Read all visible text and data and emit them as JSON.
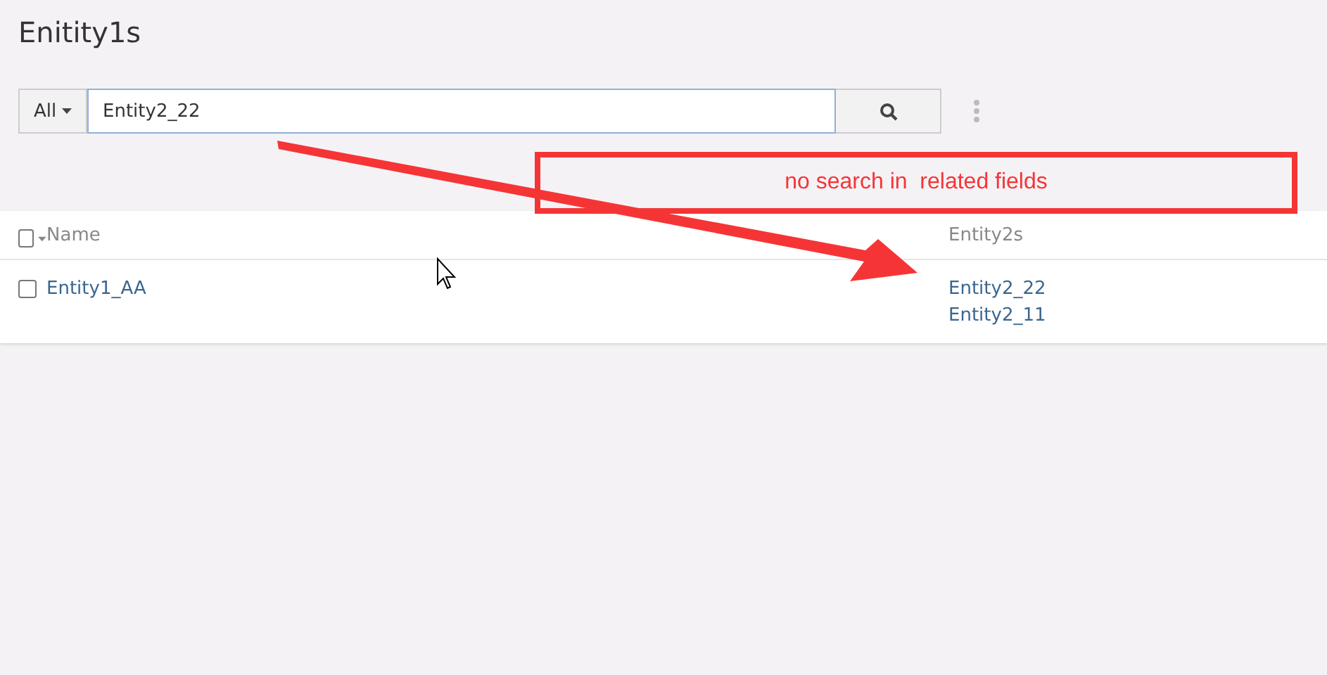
{
  "title": "Enitity1s",
  "search": {
    "scope": "All",
    "value": "Entity2_22"
  },
  "table": {
    "select_all": {
      "checked": false
    },
    "columns": [
      "Name",
      "Entity2s"
    ],
    "rows": [
      {
        "checked": false,
        "name": "Entity1_AA",
        "entity2s": [
          "Entity2_22",
          "Entity2_11"
        ]
      }
    ]
  },
  "annotation": {
    "text": "no search in  related fields"
  }
}
